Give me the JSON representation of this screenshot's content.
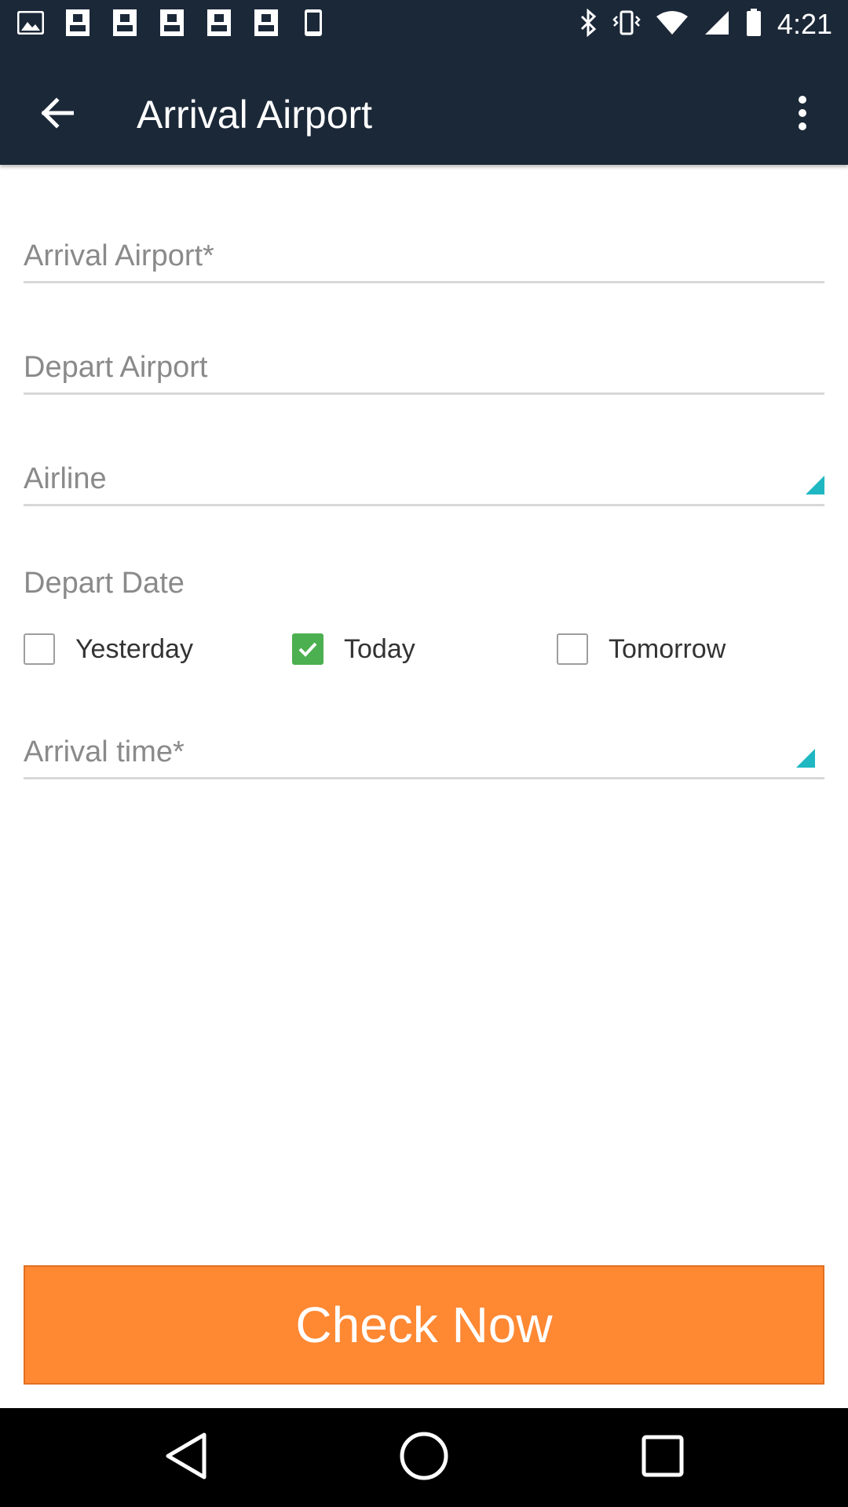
{
  "status_bar": {
    "time": "4:21",
    "left_icons": [
      "image-icon",
      "photo-icon",
      "photo-icon",
      "photo-icon",
      "photo-icon",
      "photo-icon",
      "phone-icon"
    ],
    "right_icons": [
      "bluetooth-icon",
      "vibrate-icon",
      "wifi-icon",
      "signal-icon",
      "battery-icon"
    ]
  },
  "app_bar": {
    "title": "Arrival Airport",
    "back_icon": "arrow-back-icon",
    "menu_icon": "more-vert-icon"
  },
  "form": {
    "arrival_airport_placeholder": "Arrival Airport*",
    "depart_airport_placeholder": "Depart Airport",
    "airline_placeholder": "Airline",
    "depart_date_label": "Depart Date",
    "date_options": [
      {
        "label": "Yesterday",
        "checked": false
      },
      {
        "label": "Today",
        "checked": true
      },
      {
        "label": "Tomorrow",
        "checked": false
      }
    ],
    "arrival_time_placeholder": "Arrival time*"
  },
  "actions": {
    "check_now_label": "Check Now"
  },
  "colors": {
    "app_bar": "#1b2838",
    "accent": "#ff8833",
    "checkbox_checked": "#4caf50",
    "spinner_indicator": "#1fb7c2"
  }
}
